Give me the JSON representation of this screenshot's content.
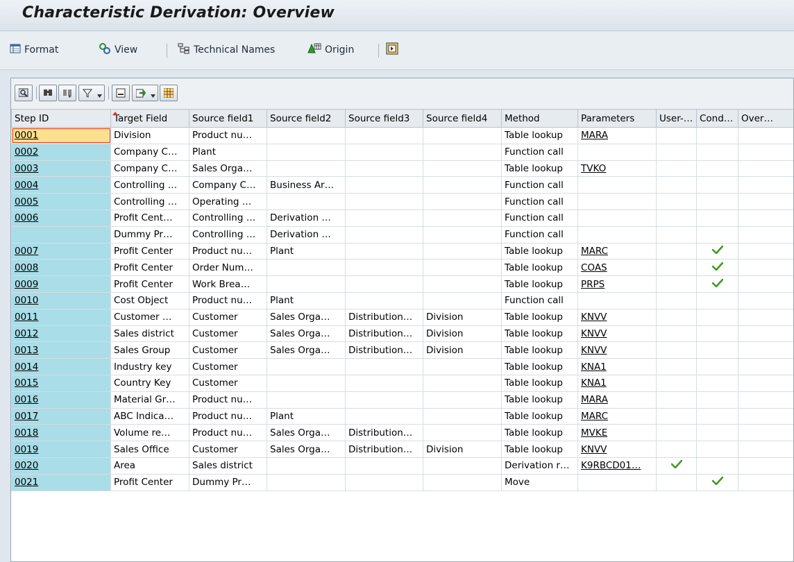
{
  "window": {
    "title": "Characteristic Derivation: Overview"
  },
  "toolbar": {
    "format_label": "Format",
    "view_label": "View",
    "technical_names_label": "Technical Names",
    "origin_label": "Origin"
  },
  "grid": {
    "columns": [
      "Step ID",
      "Target Field",
      "Source field1",
      "Source field2",
      "Source field3",
      "Source field4",
      "Method",
      "Parameters",
      "User-…",
      "Cond…",
      "Over…"
    ],
    "rows": [
      {
        "step": "0001",
        "target": "Division",
        "src1": "Product nu…",
        "src2": "",
        "src3": "",
        "src4": "",
        "method": "Table lookup",
        "param": "MARA",
        "user": false,
        "cond": false,
        "over": false
      },
      {
        "step": "0002",
        "target": "Company C…",
        "src1": "Plant",
        "src2": "",
        "src3": "",
        "src4": "",
        "method": "Function call",
        "param": "",
        "user": false,
        "cond": false,
        "over": false
      },
      {
        "step": "0003",
        "target": "Company C…",
        "src1": "Sales Orga…",
        "src2": "",
        "src3": "",
        "src4": "",
        "method": "Table lookup",
        "param": "TVKO",
        "user": false,
        "cond": false,
        "over": false
      },
      {
        "step": "0004",
        "target": "Controlling …",
        "src1": "Company C…",
        "src2": "Business Ar…",
        "src3": "",
        "src4": "",
        "method": "Function call",
        "param": "",
        "user": false,
        "cond": false,
        "over": false
      },
      {
        "step": "0005",
        "target": "Controlling …",
        "src1": "Operating …",
        "src2": "",
        "src3": "",
        "src4": "",
        "method": "Function call",
        "param": "",
        "user": false,
        "cond": false,
        "over": false
      },
      {
        "step": "0006",
        "target": "Profit Cent…",
        "src1": "Controlling …",
        "src2": "Derivation …",
        "src3": "",
        "src4": "",
        "method": "Function call",
        "param": "",
        "user": false,
        "cond": false,
        "over": false
      },
      {
        "step": "",
        "target": "Dummy Pr…",
        "src1": "Controlling …",
        "src2": "Derivation …",
        "src3": "",
        "src4": "",
        "method": "Function call",
        "param": "",
        "user": false,
        "cond": false,
        "over": false
      },
      {
        "step": "0007",
        "target": "Profit Center",
        "src1": "Product nu…",
        "src2": "Plant",
        "src3": "",
        "src4": "",
        "method": "Table lookup",
        "param": "MARC",
        "user": false,
        "cond": true,
        "over": false
      },
      {
        "step": "0008",
        "target": "Profit Center",
        "src1": "Order Num…",
        "src2": "",
        "src3": "",
        "src4": "",
        "method": "Table lookup",
        "param": "COAS",
        "user": false,
        "cond": true,
        "over": false
      },
      {
        "step": "0009",
        "target": "Profit Center",
        "src1": "Work Brea…",
        "src2": "",
        "src3": "",
        "src4": "",
        "method": "Table lookup",
        "param": "PRPS",
        "user": false,
        "cond": true,
        "over": false
      },
      {
        "step": "0010",
        "target": "Cost Object",
        "src1": "Product nu…",
        "src2": "Plant",
        "src3": "",
        "src4": "",
        "method": "Function call",
        "param": "",
        "user": false,
        "cond": false,
        "over": false
      },
      {
        "step": "0011",
        "target": "Customer …",
        "src1": "Customer",
        "src2": "Sales Orga…",
        "src3": "Distribution…",
        "src4": "Division",
        "method": "Table lookup",
        "param": "KNVV",
        "user": false,
        "cond": false,
        "over": false
      },
      {
        "step": "0012",
        "target": "Sales district",
        "src1": "Customer",
        "src2": "Sales Orga…",
        "src3": "Distribution…",
        "src4": "Division",
        "method": "Table lookup",
        "param": "KNVV",
        "user": false,
        "cond": false,
        "over": false
      },
      {
        "step": "0013",
        "target": "Sales Group",
        "src1": "Customer",
        "src2": "Sales Orga…",
        "src3": "Distribution…",
        "src4": "Division",
        "method": "Table lookup",
        "param": "KNVV",
        "user": false,
        "cond": false,
        "over": false
      },
      {
        "step": "0014",
        "target": "Industry key",
        "src1": "Customer",
        "src2": "",
        "src3": "",
        "src4": "",
        "method": "Table lookup",
        "param": "KNA1",
        "user": false,
        "cond": false,
        "over": false
      },
      {
        "step": "0015",
        "target": "Country Key",
        "src1": "Customer",
        "src2": "",
        "src3": "",
        "src4": "",
        "method": "Table lookup",
        "param": "KNA1",
        "user": false,
        "cond": false,
        "over": false
      },
      {
        "step": "0016",
        "target": "Material Gr…",
        "src1": "Product nu…",
        "src2": "",
        "src3": "",
        "src4": "",
        "method": "Table lookup",
        "param": "MARA",
        "user": false,
        "cond": false,
        "over": false
      },
      {
        "step": "0017",
        "target": "ABC Indica…",
        "src1": "Product nu…",
        "src2": "Plant",
        "src3": "",
        "src4": "",
        "method": "Table lookup",
        "param": "MARC",
        "user": false,
        "cond": false,
        "over": false
      },
      {
        "step": "0018",
        "target": "Volume re…",
        "src1": "Product nu…",
        "src2": "Sales Orga…",
        "src3": "Distribution…",
        "src4": "",
        "method": "Table lookup",
        "param": "MVKE",
        "user": false,
        "cond": false,
        "over": false
      },
      {
        "step": "0019",
        "target": "Sales Office",
        "src1": "Customer",
        "src2": "Sales Orga…",
        "src3": "Distribution…",
        "src4": "Division",
        "method": "Table lookup",
        "param": "KNVV",
        "user": false,
        "cond": false,
        "over": false
      },
      {
        "step": "0020",
        "target": "Area",
        "src1": "Sales district",
        "src2": "",
        "src3": "",
        "src4": "",
        "method": "Derivation r…",
        "param": "K9RBCD01…",
        "user": true,
        "cond": false,
        "over": false
      },
      {
        "step": "0021",
        "target": "Profit Center",
        "src1": "Dummy Pr…",
        "src2": "",
        "src3": "",
        "src4": "",
        "method": "Move",
        "param": "",
        "user": false,
        "cond": true,
        "over": false
      }
    ]
  },
  "colors": {
    "key_cell": "#a9dde8",
    "selected_cell": "#fbe08f",
    "check": "#3f9a1f"
  }
}
